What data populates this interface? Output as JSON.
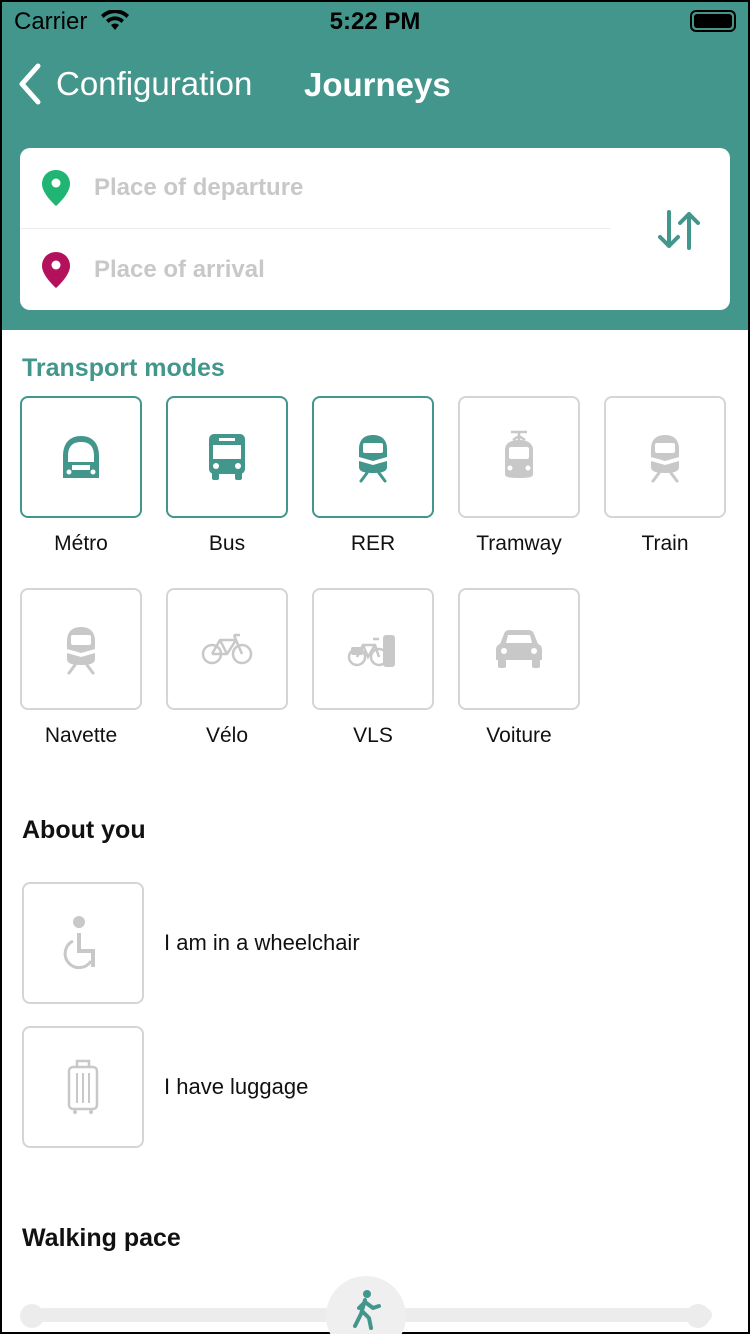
{
  "status_bar": {
    "carrier": "Carrier",
    "time": "5:22 PM"
  },
  "nav": {
    "back_label": "Configuration",
    "title": "Journeys"
  },
  "search": {
    "departure_placeholder": "Place of departure",
    "arrival_placeholder": "Place of arrival"
  },
  "transport": {
    "title": "Transport modes",
    "modes": [
      {
        "label": "Métro",
        "selected": true,
        "icon": "metro-icon"
      },
      {
        "label": "Bus",
        "selected": true,
        "icon": "bus-icon"
      },
      {
        "label": "RER",
        "selected": true,
        "icon": "rer-icon"
      },
      {
        "label": "Tramway",
        "selected": false,
        "icon": "tram-icon"
      },
      {
        "label": "Train",
        "selected": false,
        "icon": "train-icon"
      },
      {
        "label": "Navette",
        "selected": false,
        "icon": "shuttle-icon"
      },
      {
        "label": "Vélo",
        "selected": false,
        "icon": "bike-icon"
      },
      {
        "label": "VLS",
        "selected": false,
        "icon": "bike-share-icon"
      },
      {
        "label": "Voiture",
        "selected": false,
        "icon": "car-icon"
      }
    ]
  },
  "about": {
    "title": "About you",
    "wheelchair": "I am in a wheelchair",
    "luggage": "I have luggage"
  },
  "walking": {
    "title": "Walking pace",
    "level": 0.5
  },
  "colors": {
    "accent": "#42968c",
    "departure_pin": "#21b573",
    "arrival_pin": "#b4115c",
    "inactive": "#c8c8c8"
  }
}
